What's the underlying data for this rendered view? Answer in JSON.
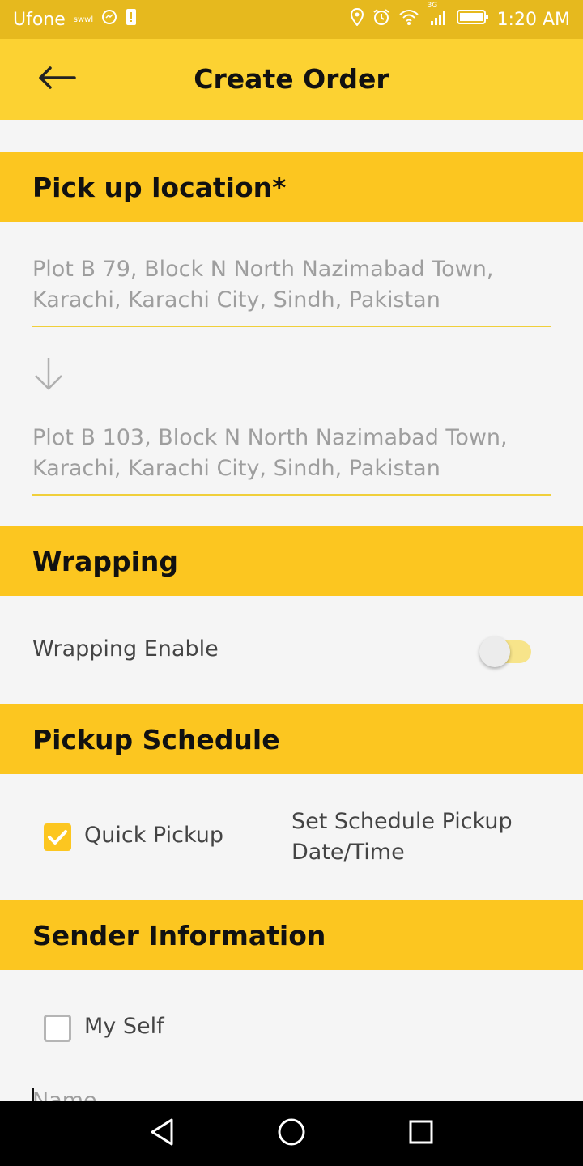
{
  "status_bar": {
    "carrier": "Ufone",
    "carrier_sub": "swwl",
    "network": "3G",
    "time": "1:20 AM",
    "icons": [
      "messenger-icon",
      "sim-alert-icon",
      "location-icon",
      "alarm-icon",
      "wifi-icon",
      "signal-icon",
      "battery-icon"
    ]
  },
  "app_bar": {
    "title": "Create Order",
    "back_icon": "arrow-left-icon"
  },
  "sections": {
    "pickup": {
      "header": "Pick up location*",
      "from_address": "Plot B 79, Block N North Nazimabad Town, Karachi, Karachi City, Sindh, Pakistan",
      "to_address": "Plot B 103, Block N North Nazimabad Town, Karachi, Karachi City, Sindh, Pakistan",
      "arrow_icon": "arrow-down-icon"
    },
    "wrapping": {
      "header": "Wrapping",
      "toggle_label": "Wrapping Enable",
      "toggle_on": false
    },
    "schedule": {
      "header": "Pickup Schedule",
      "quick_pickup_label": "Quick Pickup",
      "quick_pickup_checked": true,
      "schedule_link": "Set Schedule Pickup Date/Time"
    },
    "sender": {
      "header": "Sender Information",
      "myself_label": "My Self",
      "myself_checked": false,
      "name_placeholder": "Name"
    }
  },
  "nav_bar": {
    "buttons": [
      "back-triangle-icon",
      "home-circle-icon",
      "recents-square-icon"
    ]
  },
  "colors": {
    "status_bar": "#e6b91e",
    "app_bar": "#fcd232",
    "section_header": "#fcc620",
    "underline": "#f0cf3a"
  }
}
